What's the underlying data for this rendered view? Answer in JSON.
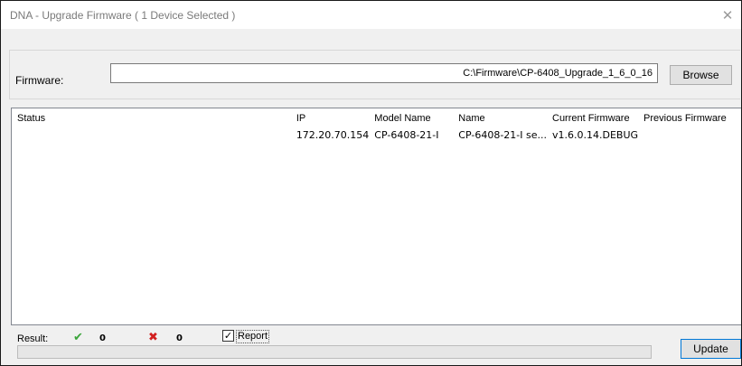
{
  "window": {
    "title": "DNA - Upgrade Firmware ( 1 Device Selected )",
    "close_glyph": "✕"
  },
  "firmware": {
    "label": "Firmware:",
    "path": "C:\\Firmware\\CP-6408_Upgrade_1_6_0_16",
    "browse_label": "Browse"
  },
  "table": {
    "headers": {
      "status": "Status",
      "ip": "IP",
      "model": "Model Name",
      "name": "Name",
      "current": "Current Firmware",
      "previous": "Previous Firmware"
    },
    "rows": [
      {
        "status": "",
        "ip": "172.20.70.154",
        "model": "CP-6408-21-I",
        "name": "CP-6408-21-I se...",
        "current": "v1.6.0.14.DEBUG",
        "previous": ""
      }
    ]
  },
  "result": {
    "label": "Result:",
    "success_icon": "check-icon",
    "success_glyph": "✔",
    "success_count": "0",
    "fail_icon": "cross-icon",
    "fail_glyph": "✖",
    "fail_count": "0",
    "report_label": "Report",
    "report_checked": true,
    "report_check_glyph": "✓",
    "progress": 0
  },
  "actions": {
    "update_label": "Update"
  },
  "colors": {
    "success": "#3aa53a",
    "fail": "#d21f1f",
    "focus_border": "#0078d7"
  }
}
